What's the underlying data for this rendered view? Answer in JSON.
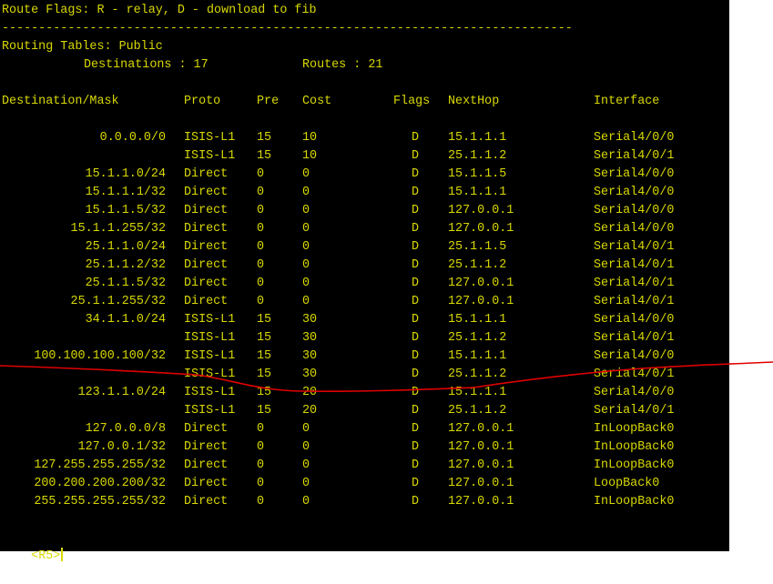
{
  "terminal": {
    "flags_legend": "Route Flags: R - relay, D - download to fib",
    "separator": "------------------------------------------------------------------------------",
    "table_title": "Routing Tables: Public",
    "destinations_text": "Destinations : 17",
    "routes_text": "Routes : 21",
    "columns": [
      "Destination/Mask",
      "Proto",
      "Pre",
      "Cost",
      "Flags",
      "NextHop",
      "Interface"
    ],
    "routes": [
      {
        "dest": "0.0.0.0/0",
        "proto": "ISIS-L1",
        "pre": "15",
        "cost": "10",
        "flags": "D",
        "nexthop": "15.1.1.1",
        "iface": "Serial4/0/0"
      },
      {
        "dest": "",
        "proto": "ISIS-L1",
        "pre": "15",
        "cost": "10",
        "flags": "D",
        "nexthop": "25.1.1.2",
        "iface": "Serial4/0/1"
      },
      {
        "dest": "15.1.1.0/24",
        "proto": "Direct",
        "pre": "0",
        "cost": "0",
        "flags": "D",
        "nexthop": "15.1.1.5",
        "iface": "Serial4/0/0"
      },
      {
        "dest": "15.1.1.1/32",
        "proto": "Direct",
        "pre": "0",
        "cost": "0",
        "flags": "D",
        "nexthop": "15.1.1.1",
        "iface": "Serial4/0/0"
      },
      {
        "dest": "15.1.1.5/32",
        "proto": "Direct",
        "pre": "0",
        "cost": "0",
        "flags": "D",
        "nexthop": "127.0.0.1",
        "iface": "Serial4/0/0"
      },
      {
        "dest": "15.1.1.255/32",
        "proto": "Direct",
        "pre": "0",
        "cost": "0",
        "flags": "D",
        "nexthop": "127.0.0.1",
        "iface": "Serial4/0/0"
      },
      {
        "dest": "25.1.1.0/24",
        "proto": "Direct",
        "pre": "0",
        "cost": "0",
        "flags": "D",
        "nexthop": "25.1.1.5",
        "iface": "Serial4/0/1"
      },
      {
        "dest": "25.1.1.2/32",
        "proto": "Direct",
        "pre": "0",
        "cost": "0",
        "flags": "D",
        "nexthop": "25.1.1.2",
        "iface": "Serial4/0/1"
      },
      {
        "dest": "25.1.1.5/32",
        "proto": "Direct",
        "pre": "0",
        "cost": "0",
        "flags": "D",
        "nexthop": "127.0.0.1",
        "iface": "Serial4/0/1"
      },
      {
        "dest": "25.1.1.255/32",
        "proto": "Direct",
        "pre": "0",
        "cost": "0",
        "flags": "D",
        "nexthop": "127.0.0.1",
        "iface": "Serial4/0/1"
      },
      {
        "dest": "34.1.1.0/24",
        "proto": "ISIS-L1",
        "pre": "15",
        "cost": "30",
        "flags": "D",
        "nexthop": "15.1.1.1",
        "iface": "Serial4/0/0"
      },
      {
        "dest": "",
        "proto": "ISIS-L1",
        "pre": "15",
        "cost": "30",
        "flags": "D",
        "nexthop": "25.1.1.2",
        "iface": "Serial4/0/1"
      },
      {
        "dest": "100.100.100.100/32",
        "proto": "ISIS-L1",
        "pre": "15",
        "cost": "30",
        "flags": "D",
        "nexthop": "15.1.1.1",
        "iface": "Serial4/0/0"
      },
      {
        "dest": "",
        "proto": "ISIS-L1",
        "pre": "15",
        "cost": "30",
        "flags": "D",
        "nexthop": "25.1.1.2",
        "iface": "Serial4/0/1"
      },
      {
        "dest": "123.1.1.0/24",
        "proto": "ISIS-L1",
        "pre": "15",
        "cost": "20",
        "flags": "D",
        "nexthop": "15.1.1.1",
        "iface": "Serial4/0/0"
      },
      {
        "dest": "",
        "proto": "ISIS-L1",
        "pre": "15",
        "cost": "20",
        "flags": "D",
        "nexthop": "25.1.1.2",
        "iface": "Serial4/0/1"
      },
      {
        "dest": "127.0.0.0/8",
        "proto": "Direct",
        "pre": "0",
        "cost": "0",
        "flags": "D",
        "nexthop": "127.0.0.1",
        "iface": "InLoopBack0"
      },
      {
        "dest": "127.0.0.1/32",
        "proto": "Direct",
        "pre": "0",
        "cost": "0",
        "flags": "D",
        "nexthop": "127.0.0.1",
        "iface": "InLoopBack0"
      },
      {
        "dest": "127.255.255.255/32",
        "proto": "Direct",
        "pre": "0",
        "cost": "0",
        "flags": "D",
        "nexthop": "127.0.0.1",
        "iface": "InLoopBack0"
      },
      {
        "dest": "200.200.200.200/32",
        "proto": "Direct",
        "pre": "0",
        "cost": "0",
        "flags": "D",
        "nexthop": "127.0.0.1",
        "iface": "LoopBack0"
      },
      {
        "dest": "255.255.255.255/32",
        "proto": "Direct",
        "pre": "0",
        "cost": "0",
        "flags": "D",
        "nexthop": "127.0.0.1",
        "iface": "InLoopBack0"
      }
    ],
    "prompt": "<R5>"
  },
  "colors": {
    "terminal_background": "#000000",
    "terminal_text": "#d8d800",
    "page_background": "#ffffff",
    "annotation_stroke": "#e00000"
  }
}
